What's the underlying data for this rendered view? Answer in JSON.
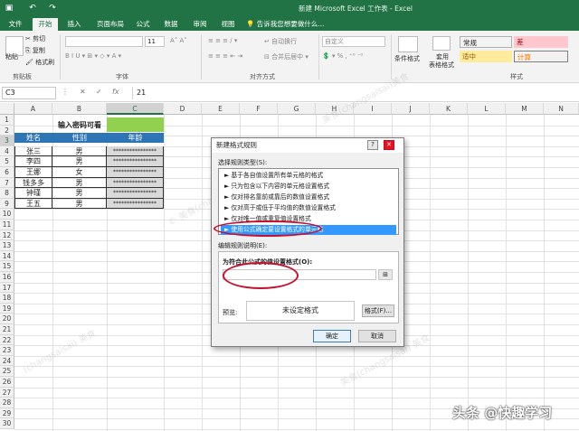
{
  "titlebar": {
    "title": "新建 Microsoft Excel 工作表 - Excel",
    "save_icon": "save-icon",
    "undo_icon": "undo-icon",
    "redo_icon": "redo-icon"
  },
  "tabs": [
    "文件",
    "开始",
    "插入",
    "页面布局",
    "公式",
    "数据",
    "审阅",
    "视图"
  ],
  "tell_me": "告诉我您想要做什么...",
  "ribbon": {
    "paste": "粘贴",
    "cut": "剪切",
    "copy": "复制",
    "format_painter": "格式刷",
    "clipboard_label": "剪贴板",
    "font_size": "11",
    "font_label": "字体",
    "wrap_text": "自动换行",
    "merge_center": "合并后居中",
    "align_label": "对齐方式",
    "number_format": "自定义",
    "conditional_format": "条件格式",
    "table_format_l1": "套用",
    "table_format_l2": "表格格式",
    "styles_label": "样式",
    "styles": [
      {
        "label": "常规",
        "bg": "#ffffff",
        "color": "#222222"
      },
      {
        "label": "差",
        "bg": "#ffc7ce",
        "color": "#9c0006"
      },
      {
        "label": "适中",
        "bg": "#ffeb9c",
        "color": "#9c5700"
      },
      {
        "label": "计算",
        "bg": "#f2f2f2",
        "color": "#fa7d00"
      }
    ]
  },
  "formula_bar": {
    "name_box": "C3",
    "cancel": "✕",
    "enter": "✓",
    "fx": "fx",
    "value": "21"
  },
  "columns": [
    "A",
    "B",
    "C",
    "D",
    "E",
    "F",
    "G",
    "H",
    "I",
    "J",
    "K",
    "L",
    "M",
    "N"
  ],
  "rows": [
    "1",
    "2",
    "3",
    "4",
    "5",
    "6",
    "7",
    "8",
    "9",
    "10",
    "11",
    "12",
    "13",
    "14",
    "15",
    "16",
    "17",
    "18",
    "19",
    "20",
    "21",
    "22",
    "23",
    "24",
    "25",
    "26",
    "27",
    "28",
    "29",
    "30"
  ],
  "sheet": {
    "title": "输入密码可看",
    "headers": [
      "姓名",
      "性别",
      "年龄"
    ],
    "data": [
      [
        "张三",
        "男",
        "****************"
      ],
      [
        "李四",
        "男",
        "****************"
      ],
      [
        "王娜",
        "女",
        "****************"
      ],
      [
        "钱多多",
        "男",
        "****************"
      ],
      [
        "钟瑾",
        "男",
        "****************"
      ],
      [
        "王五",
        "男",
        "****************"
      ]
    ],
    "header_bg": "#2e75b6",
    "title_fill": "#92d050"
  },
  "dialog": {
    "title": "新建格式规则",
    "help": "?",
    "close": "✕",
    "select_type_label": "选择规则类型(S):",
    "rules": [
      "► 基于各自值设置所有单元格的格式",
      "► 只为包含以下内容的单元格设置格式",
      "► 仅对排名靠前或靠后的数值设置格式",
      "► 仅对高于或低于平均值的数值设置格式",
      "► 仅对唯一值或重复值设置格式",
      "► 使用公式确定要设置格式的单元格"
    ],
    "edit_desc_label": "编辑规则说明(E):",
    "formula_label": "为符合此公式的值设置格式(O):",
    "formula_value": "",
    "preview_label": "预览:",
    "preview_text": "未设定格式",
    "format_button": "格式(F)...",
    "ok_button": "确定",
    "cancel_button": "取消"
  },
  "watermark": "头条 @快趣学习",
  "accent": "#217346"
}
